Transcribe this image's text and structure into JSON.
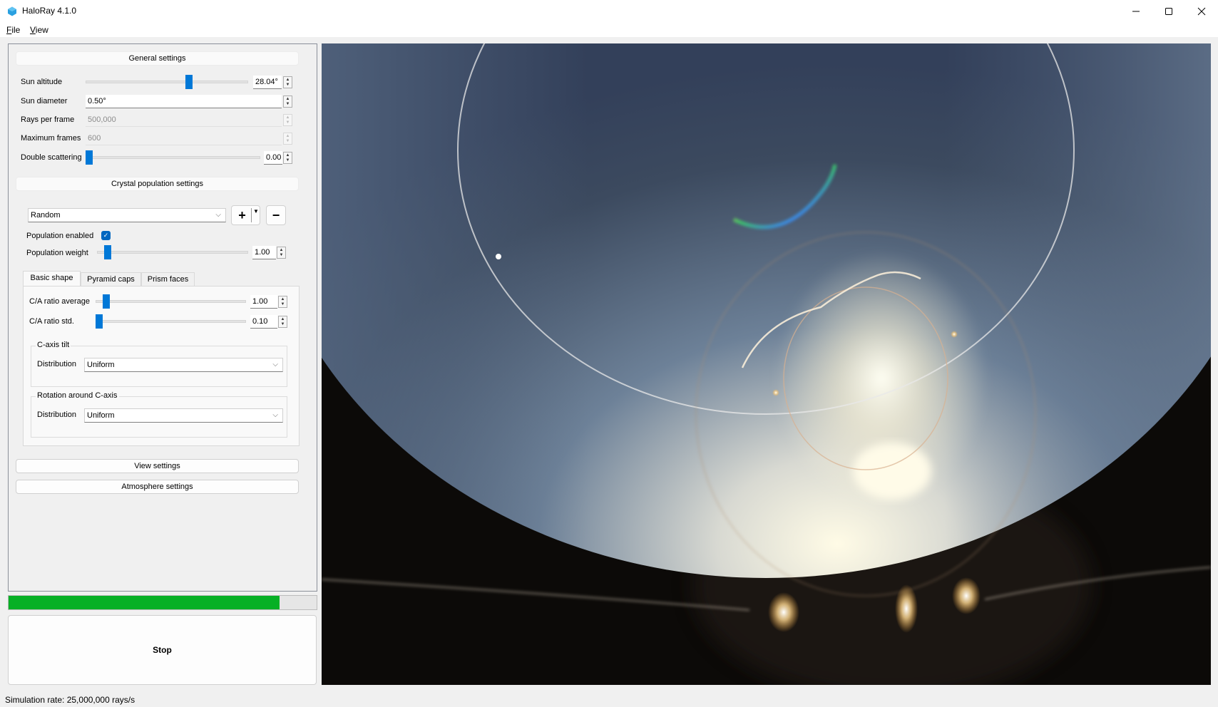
{
  "window": {
    "title": "HaloRay 4.1.0",
    "icon": "hexagon-app-icon",
    "controls": [
      "minimize",
      "maximize",
      "close"
    ]
  },
  "menu": {
    "items": [
      {
        "label": "File",
        "mnemonic": "F"
      },
      {
        "label": "View",
        "mnemonic": "V"
      }
    ]
  },
  "general_settings": {
    "header": "General settings",
    "sun_altitude": {
      "label": "Sun altitude",
      "value": "28.04°",
      "slider_fraction": 0.64
    },
    "sun_diameter": {
      "label": "Sun diameter",
      "value": "0.50°"
    },
    "rays_per_frame": {
      "label": "Rays per frame",
      "value": "500,000",
      "enabled": false
    },
    "maximum_frames": {
      "label": "Maximum frames",
      "value": "600",
      "enabled": false
    },
    "double_scattering": {
      "label": "Double scattering",
      "value": "0.00",
      "slider_fraction": 0.0
    }
  },
  "crystal_population": {
    "header": "Crystal population settings",
    "selected_population": "Random",
    "add_button": "+",
    "remove_button": "−",
    "population_enabled": {
      "label": "Population enabled",
      "checked": true
    },
    "population_weight": {
      "label": "Population weight",
      "value": "1.00",
      "slider_fraction": 0.05
    },
    "tabs": [
      {
        "label": "Basic shape",
        "active": true
      },
      {
        "label": "Pyramid caps",
        "active": false
      },
      {
        "label": "Prism faces",
        "active": false
      }
    ],
    "ca_ratio_average": {
      "label": "C/A ratio average",
      "value": "1.00",
      "slider_fraction": 0.05
    },
    "ca_ratio_std": {
      "label": "C/A ratio std.",
      "value": "0.10",
      "slider_fraction": 0.0
    },
    "c_axis_tilt": {
      "title": "C-axis tilt",
      "distribution_label": "Distribution",
      "distribution": "Uniform"
    },
    "rotation_c_axis": {
      "title": "Rotation around C-axis",
      "distribution_label": "Distribution",
      "distribution": "Uniform"
    }
  },
  "view_settings_button": "View settings",
  "atmosphere_settings_button": "Atmosphere settings",
  "progress": {
    "fraction": 0.88
  },
  "stop_button": "Stop",
  "status_bar": {
    "text": "Simulation rate: 25,000,000 rays/s"
  },
  "render": {
    "description": "Simulated ice-crystal halo display with 22° halo, circumzenithal arc, parhelic circle and parhelia"
  }
}
